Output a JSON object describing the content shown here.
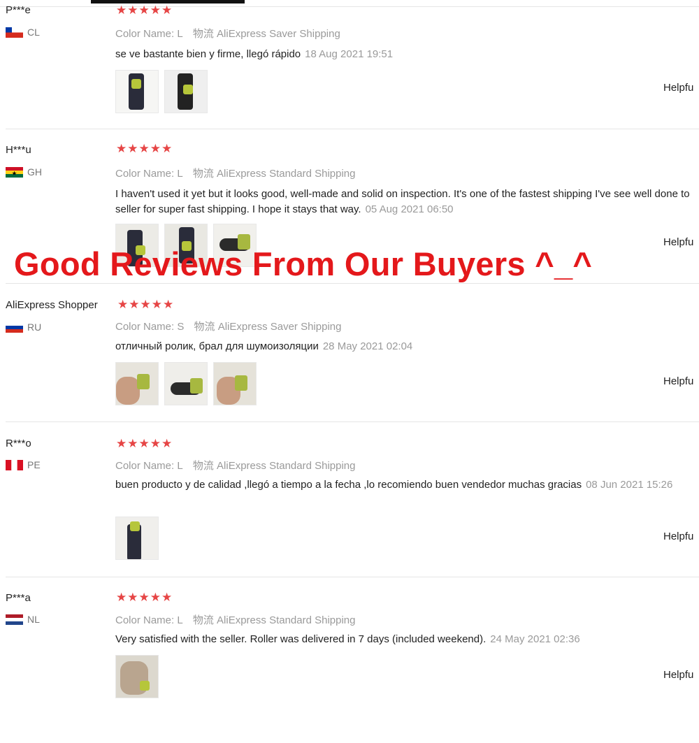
{
  "banner": {
    "text": "Good Reviews From Our Buyers ^_^",
    "color": "#e4181b"
  },
  "colors": {
    "star": "#e64545",
    "muted": "#9a9a9a"
  },
  "helpful_label": "Helpfu",
  "reviews": [
    {
      "user": "P***e",
      "country": "CL",
      "flag": "chile-flag",
      "stars": "★★★★★",
      "color_name": "Color Name: L",
      "logistics": "物流 AliExpress Saver Shipping",
      "comment": "se ve bastante bien y firme, llegó rápido",
      "date": "18 Aug 2021 19:51",
      "photos": 2
    },
    {
      "user": "H***u",
      "country": "GH",
      "flag": "ghana-flag",
      "stars": "★★★★★",
      "color_name": "Color Name: L",
      "logistics": "物流 AliExpress Standard Shipping",
      "comment": "I haven't used it yet but it looks good, well-made and solid on inspection. It's one of the fastest shipping I've see well done to seller for super fast shipping. I hope it stays that way.",
      "date": "05 Aug 2021 06:50",
      "photos": 3
    },
    {
      "user": "AliExpress Shopper",
      "country": "RU",
      "flag": "russia-flag",
      "stars": "★★★★★",
      "color_name": "Color Name: S",
      "logistics": "物流 AliExpress Saver Shipping",
      "comment": "отличный ролик, брал для шумоизоляции",
      "date": "28 May 2021 02:04",
      "photos": 3
    },
    {
      "user": "R***o",
      "country": "PE",
      "flag": "peru-flag",
      "stars": "★★★★★",
      "color_name": "Color Name: L",
      "logistics": "物流 AliExpress Standard Shipping",
      "comment": "buen producto y de calidad ,llegó a tiempo a la fecha ,lo recomiendo buen vendedor muchas gracias",
      "date": "08 Jun 2021 15:26",
      "photos": 1
    },
    {
      "user": "P***a",
      "country": "NL",
      "flag": "netherlands-flag",
      "stars": "★★★★★",
      "color_name": "Color Name: L",
      "logistics": "物流 AliExpress Standard Shipping",
      "comment": "Very satisfied with the seller. Roller was delivered in 7 days (included weekend).",
      "date": "24 May 2021 02:36",
      "photos": 1
    }
  ]
}
